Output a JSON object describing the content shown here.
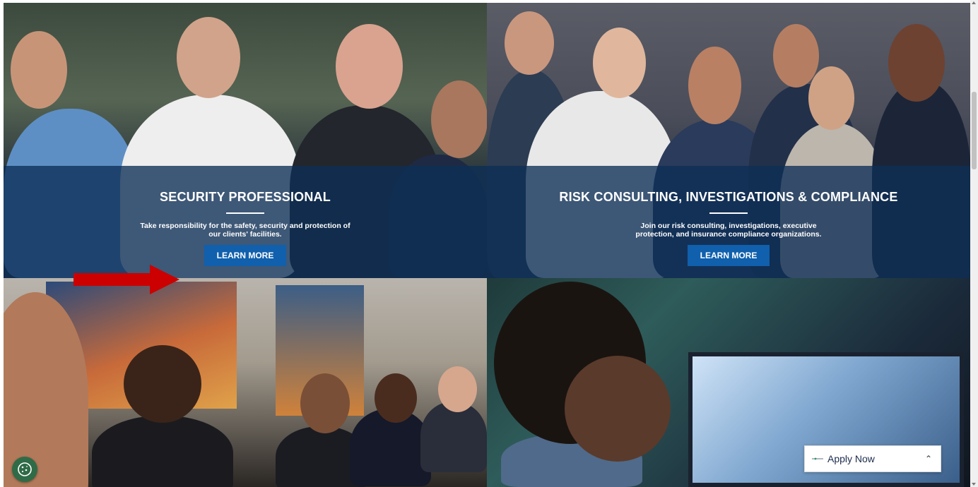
{
  "tiles": [
    {
      "title": "SECURITY PROFESSIONAL",
      "description": "Take responsibility for the safety, security and protection of our clients' facilities.",
      "button_label": "LEARN MORE"
    },
    {
      "title": "RISK CONSULTING, INVESTIGATIONS & COMPLIANCE",
      "description": "Join our risk consulting, investigations, executive protection, and insurance compliance organizations.",
      "button_label": "LEARN MORE"
    }
  ],
  "apply_widget": {
    "label": "Apply Now",
    "chevron_icon": "chevron-up-icon"
  },
  "cookie_button": {
    "icon": "cookie-icon"
  },
  "annotation": {
    "icon": "red-arrow-icon",
    "color": "#cc0000"
  },
  "colors": {
    "overlay": "#0d2e56",
    "button": "#1060ad",
    "cookie": "#2f6b46"
  }
}
